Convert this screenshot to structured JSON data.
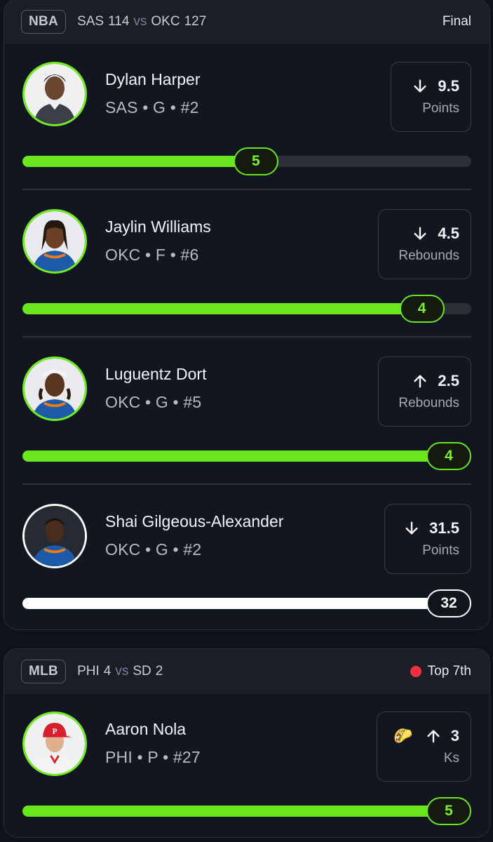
{
  "games": [
    {
      "league": "NBA",
      "away_team": "SAS",
      "away_score": "114",
      "vs": "vs",
      "home_team": "OKC",
      "home_score": "127",
      "status": "Final",
      "players": [
        {
          "name": "Dylan Harper",
          "meta": "SAS • G • #2",
          "direction": "down",
          "line": "9.5",
          "stat": "Points",
          "actual": "5",
          "fill": 0.52,
          "color": "green"
        },
        {
          "name": "Jaylin Williams",
          "meta": "OKC • F • #6",
          "direction": "down",
          "line": "4.5",
          "stat": "Rebounds",
          "actual": "4",
          "fill": 0.89,
          "color": "green"
        },
        {
          "name": "Luguentz Dort",
          "meta": "OKC • G • #5",
          "direction": "up",
          "line": "2.5",
          "stat": "Rebounds",
          "actual": "4",
          "fill": 1.0,
          "color": "green"
        },
        {
          "name": "Shai Gilgeous-Alexander",
          "meta": "OKC • G • #2",
          "direction": "down",
          "line": "31.5",
          "stat": "Points",
          "actual": "32",
          "fill": 1.0,
          "color": "white"
        }
      ]
    },
    {
      "league": "MLB",
      "away_team": "PHI",
      "away_score": "4",
      "vs": "vs",
      "home_team": "SD",
      "home_score": "2",
      "status": "Top 7th",
      "live": true,
      "players": [
        {
          "name": "Aaron Nola",
          "meta": "PHI • P • #27",
          "emoji": "🌮",
          "direction": "up",
          "line": "3",
          "stat": "Ks",
          "actual": "5",
          "fill": 1.0,
          "color": "green"
        }
      ]
    }
  ],
  "icons": {
    "arrow_up": "arrow-up-icon",
    "arrow_down": "arrow-down-icon",
    "live": "live-dot-icon"
  },
  "colors": {
    "accent_green": "#6ae61d",
    "live_red": "#f0303c",
    "background": "#0f121a"
  }
}
